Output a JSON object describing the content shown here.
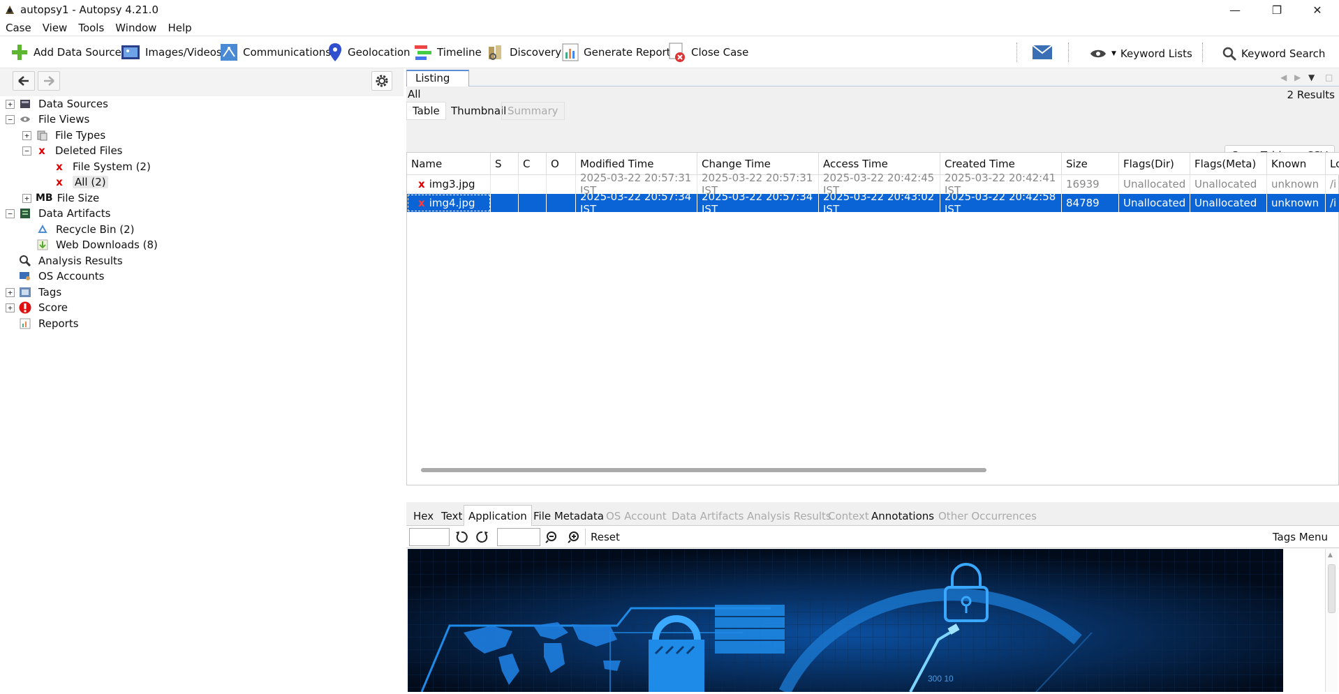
{
  "window": {
    "title": "autopsy1 - Autopsy 4.21.0",
    "min_label": "—",
    "max_label": "❐",
    "close_label": "✕"
  },
  "menu": [
    "Case",
    "View",
    "Tools",
    "Window",
    "Help"
  ],
  "toolbar": {
    "add_data_source": "Add Data Source",
    "images_videos": "Images/Videos",
    "communications": "Communications",
    "geolocation": "Geolocation",
    "timeline": "Timeline",
    "discovery": "Discovery",
    "generate_report": "Generate Report",
    "close_case": "Close Case",
    "keyword_lists": "Keyword Lists",
    "keyword_search": "Keyword Search"
  },
  "tree": {
    "data_sources": "Data Sources",
    "file_views": "File Views",
    "file_types": "File Types",
    "deleted_files": "Deleted Files",
    "file_system": "File System (2)",
    "all": "All (2)",
    "file_size": "File Size",
    "file_size_icon": "MB",
    "data_artifacts": "Data Artifacts",
    "recycle_bin": "Recycle Bin (2)",
    "web_downloads": "Web Downloads (8)",
    "analysis_results": "Analysis Results",
    "os_accounts": "OS Accounts",
    "tags": "Tags",
    "score": "Score",
    "reports": "Reports"
  },
  "listing": {
    "tab": "Listing",
    "path": "All",
    "results": "2  Results",
    "subtabs": {
      "table": "Table",
      "thumbnail": "Thumbnail",
      "summary": "Summary"
    },
    "save_csv": "Save Table as CSV",
    "columns": {
      "name": "Name",
      "s": "S",
      "c": "C",
      "o": "O",
      "modified": "Modified Time",
      "change": "Change Time",
      "access": "Access Time",
      "created": "Created Time",
      "size": "Size",
      "flags_dir": "Flags(Dir)",
      "flags_meta": "Flags(Meta)",
      "known": "Known",
      "location": "Lo"
    },
    "rows": [
      {
        "name": "img3.jpg",
        "modified": "2025-03-22 20:57:31 IST",
        "change": "2025-03-22 20:57:31 IST",
        "access": "2025-03-22 20:42:45 IST",
        "created": "2025-03-22 20:42:41 IST",
        "size": "16939",
        "flags_dir": "Unallocated",
        "flags_meta": "Unallocated",
        "known": "unknown",
        "location": "/i"
      },
      {
        "name": "img4.jpg",
        "modified": "2025-03-22 20:57:34 IST",
        "change": "2025-03-22 20:57:34 IST",
        "access": "2025-03-22 20:43:02 IST",
        "created": "2025-03-22 20:42:58 IST",
        "size": "84789",
        "flags_dir": "Unallocated",
        "flags_meta": "Unallocated",
        "known": "unknown",
        "location": "/i"
      }
    ]
  },
  "content": {
    "tabs": {
      "hex": "Hex",
      "text": "Text",
      "application": "Application",
      "file_metadata": "File Metadata",
      "os_account": "OS Account",
      "data_artifacts": "Data Artifacts",
      "analysis_results": "Analysis Results",
      "context": "Context",
      "annotations": "Annotations",
      "other_occurrences": "Other Occurrences"
    },
    "reset": "Reset",
    "tags_menu": "Tags Menu",
    "image_text": "300   10"
  },
  "colors": {
    "selection": "#0a64d6",
    "accent_tab": "#5b8dd6"
  }
}
